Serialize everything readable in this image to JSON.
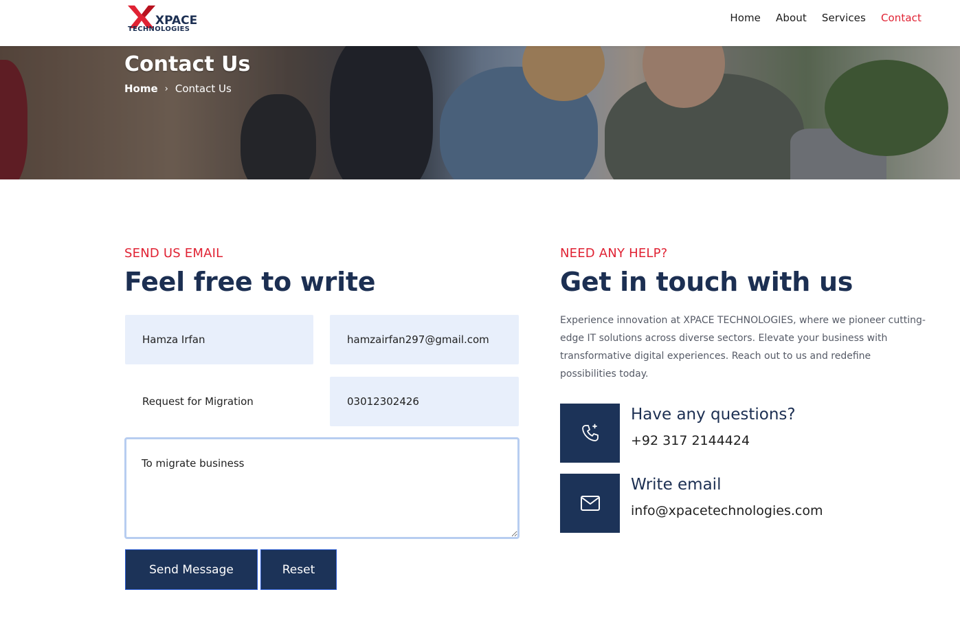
{
  "brand": {
    "word": "XPACE",
    "sub": "TECHNOLOGIES",
    "colors": {
      "red": "#e02233",
      "navy": "#1c2f52"
    }
  },
  "nav": {
    "items": [
      {
        "label": "Home"
      },
      {
        "label": "About"
      },
      {
        "label": "Services"
      },
      {
        "label": "Contact",
        "active": true
      }
    ]
  },
  "hero": {
    "title": "Contact Us",
    "breadcrumb": {
      "home": "Home",
      "separator": "›",
      "current": "Contact Us"
    }
  },
  "form_section": {
    "eyebrow": "SEND US EMAIL",
    "heading": "Feel free to write",
    "fields": {
      "name": "Hamza Irfan",
      "email": "hamzairfan297@gmail.com",
      "subject": "Request for Migration",
      "phone": "03012302426",
      "message": "To migrate business"
    },
    "buttons": {
      "send": "Send Message",
      "reset": "Reset"
    }
  },
  "help_section": {
    "eyebrow": "NEED ANY HELP?",
    "heading": "Get in touch with us",
    "intro": "Experience innovation at XPACE TECHNOLOGIES, where we pioneer cutting-edge IT solutions across diverse sectors. Elevate your business with transformative digital experiences. Reach out to us and redefine possibilities today.",
    "contacts": [
      {
        "icon": "phone-icon",
        "title": "Have any questions?",
        "value": "+92 317 2144424"
      },
      {
        "icon": "envelope-icon",
        "title": "Write email",
        "value": "info@xpacetechnologies.com"
      }
    ]
  }
}
